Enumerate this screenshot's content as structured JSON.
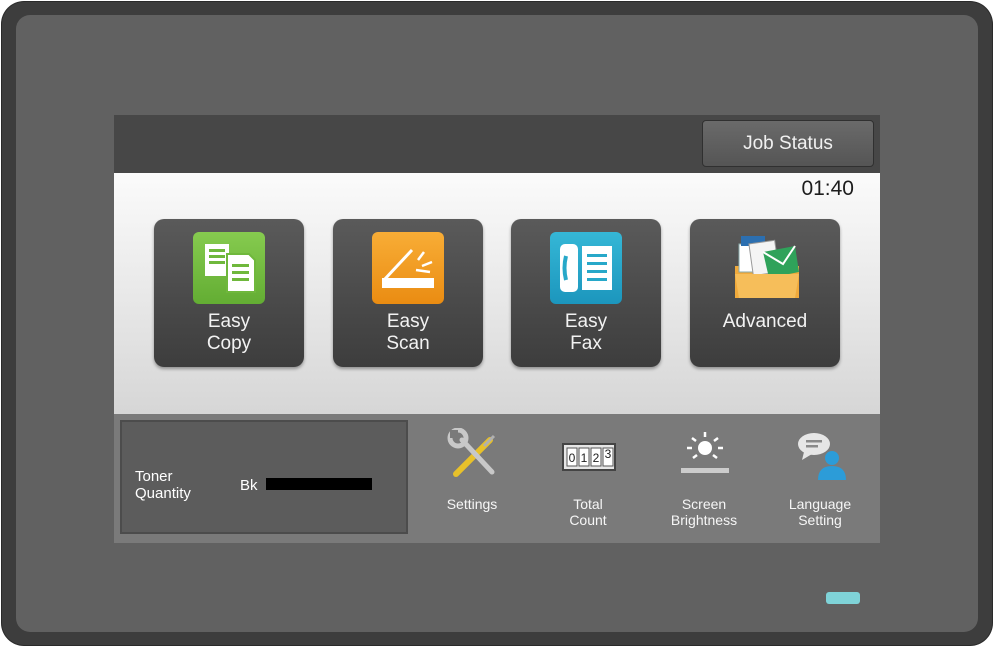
{
  "header": {
    "job_status_label": "Job Status"
  },
  "clock": "01:40",
  "tiles": [
    {
      "line1": "Easy",
      "line2": "Copy",
      "icon": "copy-icon",
      "color": "#78c043"
    },
    {
      "line1": "Easy",
      "line2": "Scan",
      "icon": "scan-icon",
      "color": "#f39a1e"
    },
    {
      "line1": "Easy",
      "line2": "Fax",
      "icon": "fax-icon",
      "color": "#27a8c9"
    },
    {
      "line1": "Advanced",
      "line2": "",
      "icon": "folder-icon",
      "color": "#f2b552"
    }
  ],
  "toner": {
    "label_line1": "Toner",
    "label_line2": "Quantity",
    "color_label": "Bk",
    "level": 1.0
  },
  "tools": [
    {
      "line1": "Settings",
      "line2": "",
      "icon": "settings-tools-icon"
    },
    {
      "line1": "Total",
      "line2": "Count",
      "icon": "counter-icon"
    },
    {
      "line1": "Screen",
      "line2": "Brightness",
      "icon": "brightness-icon"
    },
    {
      "line1": "Language",
      "line2": "Setting",
      "icon": "language-icon"
    }
  ],
  "counter_digits": [
    "0",
    "1",
    "2",
    "3"
  ],
  "colors": {
    "led": "#7fd3d8",
    "accent_blue": "#2c9cd8"
  }
}
